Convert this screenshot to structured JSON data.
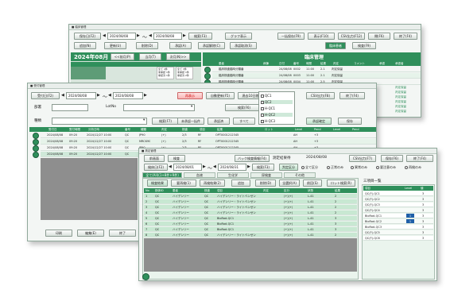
{
  "w1": {
    "title": "臨床管理",
    "btn_hold": "保存日(F2)",
    "date_a": "2024/08/08",
    "tilde": "～",
    "date_b": "2024/08/08",
    "btn_search": "検索(F3)",
    "btn_graph": "グラフ表示",
    "btn_batch": "一括保存(F9)",
    "btn_display": "表示(F10)",
    "btn_csv": "CSV出力(F12)",
    "btn_close": "閉(F6)",
    "btn_end": "終了(F4)",
    "row2": [
      "追加(N)",
      "更新(U)",
      "削除(D)",
      "承認(A)",
      "承認解除(C)",
      "承認取消(S)"
    ],
    "month": "2024年08月",
    "prev": "<<前月(P)",
    "today": "当月(T)",
    "next": "次月(N)>>",
    "section": "臨床管理",
    "tag1": "臨床患者",
    "tag2": "検査(F9)",
    "cols": [
      "患者",
      "病棟",
      "日付",
      "番号",
      "時間",
      "結果",
      "判定",
      "コメント",
      "承認",
      "承認者"
    ],
    "rows": [
      [
        "臨床検査臨時分類番",
        "24/08/08",
        "0002",
        "11:00",
        "2.1",
        "判定保留"
      ],
      [
        "臨床検査臨時分類番",
        "24/08/08",
        "0003",
        "11:00",
        "2.1",
        "判定保留"
      ],
      [
        "臨床検査臨時分類番",
        "24/08/08",
        "0004",
        "11:00",
        "2.5",
        "判定保留"
      ]
    ],
    "cal_cells": [
      "全て 4件",
      "未承認 1件",
      "承認済 1件",
      "全て 3件",
      "未承認 1件",
      "承認済 2件"
    ],
    "right_status": [
      "判定保留",
      "判定保留",
      "判定保留",
      "判定保留",
      "判定保留",
      "判定保留",
      "判定保留",
      "判定保留",
      "判定保留",
      "判定保留"
    ]
  },
  "w2": {
    "title": "受付管理",
    "btn_recv": "受付日(F2)",
    "date_a": "2024/08/08",
    "tilde": "～",
    "date_b": "2024/08/08",
    "btn_reload": "再表示",
    "btn_refresh": "自動更新(F5)",
    "btn_past": "過去10日間",
    "lbl_dept": "部署",
    "lbl_lot": "LotNo",
    "btn_search": "検索(F6)",
    "lbl_type": "種類",
    "btn_search2": "検索(F7)",
    "btn_all_check": "未承認一括件",
    "btn_approve": "承認済",
    "btn_all": "すべて",
    "checks": [
      "QC1",
      "QC2",
      "H-QC1",
      "H-QC2",
      "H-QC3"
    ],
    "btn_csv": "CSV出力(F8)",
    "btn_end": "終了(F4)",
    "btn_confirm": "承認確定",
    "btn_save": "保存",
    "cols": [
      "受付日",
      "受付時間",
      "分析日時",
      "番号",
      "種類",
      "判定",
      "検査",
      "項目",
      "結果",
      "ロット",
      "Level",
      "Pend",
      "Level",
      "Pend"
    ],
    "rows": [
      [
        "2024/08/08",
        "09:20",
        "2024/12/27 10:00",
        "QC",
        "JP90",
        "(+)",
        "2/3",
        "RF",
        "OPT0001212345",
        "AH",
        "+3"
      ],
      [
        "2024/08/08",
        "09:20",
        "2024/12/27 10:00",
        "QC",
        "MRCK90",
        "(+)",
        "2/3",
        "RF",
        "OPT0001212345",
        "AH",
        "+3"
      ],
      [
        "2024/08/08",
        "09:20",
        "2024/12/27 10:00",
        "QC",
        "JP90",
        "(+)",
        "2/3",
        "RF",
        "OPT0001212345",
        "AH",
        "+3"
      ],
      [
        "2024/08/08",
        "09:20",
        "2024/12/27 10:00",
        "QC",
        "JP90",
        "(+)",
        "2/3",
        "RF",
        "OPT0001212345",
        "AH",
        "+3"
      ]
    ],
    "btn_print": "印刷",
    "btn_edit": "編集(E)",
    "btn_end2": "終了"
  },
  "w3": {
    "title": "測定管理",
    "btn_back": "前画面",
    "btn_note": "検査",
    "btn_backup": "バック検査情報(F4)",
    "lbl_wait": "測定結果待",
    "date_top": "2024/08/08",
    "btn_csv": "CSV出力(F7)",
    "btn_save": "保存(F6)",
    "btn_end": "終了(F4)",
    "btn_recv": "検体日(F2)",
    "date_a": "2024/08/01",
    "tilde": "～",
    "date_b": "2024/08/31",
    "btn_search": "検索(F3)",
    "lbl_class": "判定区分",
    "radios": [
      "全て区分",
      "正常のみ",
      "異常のみ",
      "要注意のみ",
      "再検のみ"
    ],
    "tabs": [
      "全て(All)(1+8件+9件)",
      "血液",
      "生化学",
      "尿検査",
      "その他"
    ],
    "sub_btns": [
      "検査結果",
      "要再検(1)",
      "再検結果(2)",
      "追加",
      "削除(D)",
      "全選択(A)",
      "前回(S)",
      "ロット検索(R)"
    ],
    "lbl_side": "三項目一覧",
    "cols": [
      "No",
      "検体ID",
      "患者",
      "検査",
      "項目",
      "判定",
      "区分",
      "状態",
      "結果"
    ],
    "rows": [
      [
        "1",
        "QC",
        "ハイデンリー",
        "QC",
        "ハイデンリー・ライトベンゼン",
        "",
        "(+)(+)",
        "L-41",
        "2"
      ],
      [
        "2",
        "QC",
        "ハイデンリー",
        "QC",
        "ハイデンリー・ライトベンゼン",
        "",
        "(+)(+)",
        "L-41",
        "2"
      ],
      [
        "3",
        "QC",
        "ハイデンリー",
        "QC",
        "ハイデンリー・ライトベンゼン",
        "",
        "(+)(+)",
        "L-41",
        "2"
      ],
      [
        "4",
        "QC",
        "ハイデンリー",
        "QC",
        "ハイデンリー・ライトベンゼン",
        "",
        "(+)(+)",
        "L-41",
        "2"
      ],
      [
        "5",
        "QC",
        "ハイデンリー",
        "QC",
        "BioRad-QC1",
        "",
        "(+)(+)",
        "L-41",
        "3"
      ],
      [
        "6",
        "QC",
        "ハイデンリー",
        "QC",
        "BioRad-QC1",
        "",
        "(+)(+)",
        "L-41",
        "3"
      ],
      [
        "7",
        "QC",
        "ハイデンリー",
        "QC",
        "BioRad-QC1",
        "",
        "(+)(+)",
        "L-41",
        "3"
      ],
      [
        "8",
        "QC",
        "ハイデンリー",
        "QC",
        "ハイデンリー・ライトベンゼン",
        "",
        "(+)(+)",
        "L-41",
        "2"
      ]
    ],
    "side_cols": [
      "項目",
      "Level",
      "値"
    ],
    "side_rows": [
      [
        "QC(F)-QC1",
        "",
        "3"
      ],
      [
        "QC(F)-QC2",
        "",
        "3"
      ],
      [
        "QC(F)-QC3",
        "",
        "3"
      ],
      [
        "QC(F)-QC4",
        "",
        "3"
      ],
      [
        "BioRad-QC1",
        "1",
        "3"
      ],
      [
        "BioRad-QC2",
        "1",
        "3"
      ],
      [
        "BioRad-QC3",
        "",
        "3"
      ],
      [
        "QC(F)-QC5",
        "",
        "3"
      ],
      [
        "QC(F)-QC6",
        "",
        "3"
      ]
    ]
  }
}
